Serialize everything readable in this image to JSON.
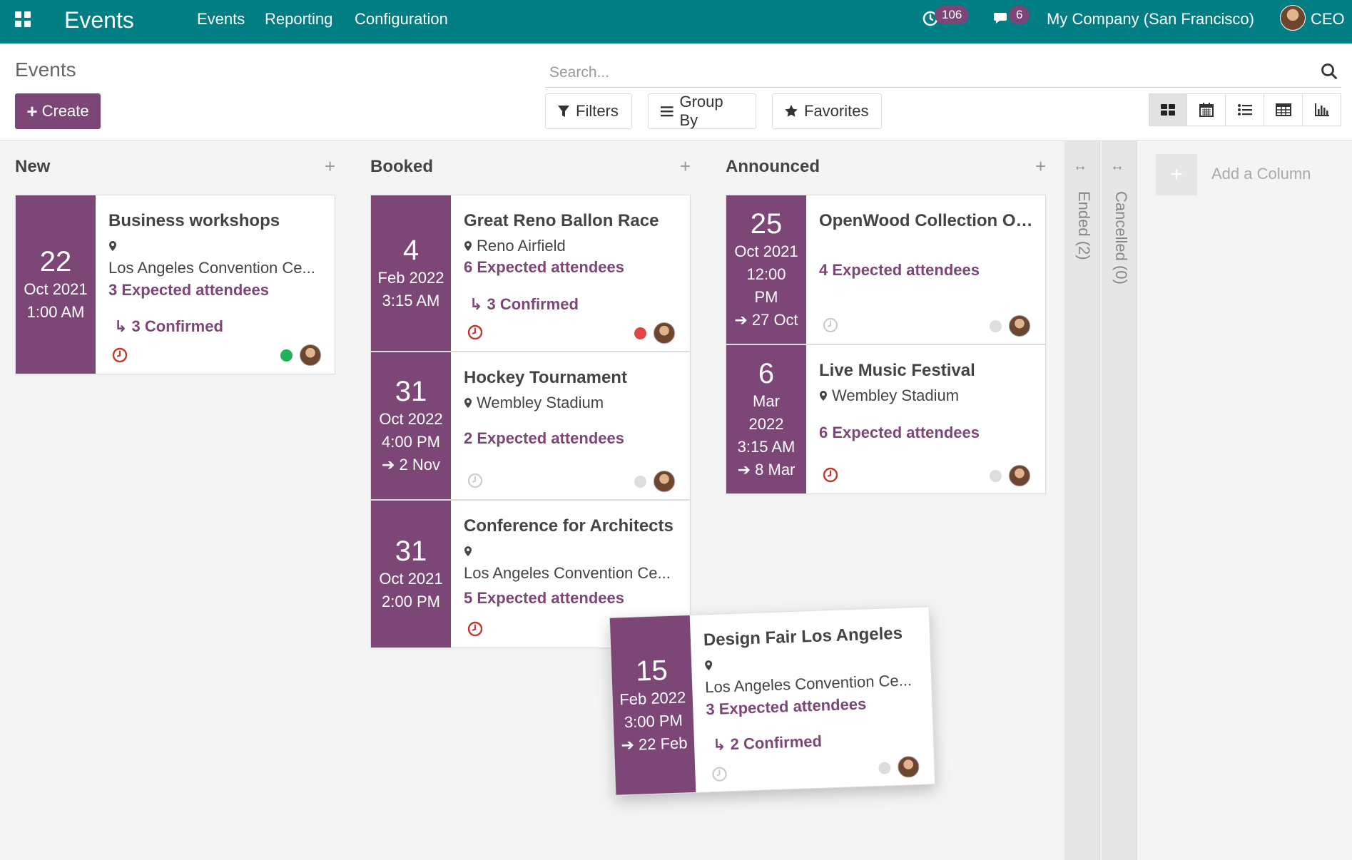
{
  "navbar": {
    "brand": "Events",
    "menu": [
      "Events",
      "Reporting",
      "Configuration"
    ],
    "activity_count": "106",
    "message_count": "6",
    "company": "My Company (San Francisco)",
    "user": "CEO"
  },
  "control_panel": {
    "title": "Events",
    "create_label": "Create",
    "search_placeholder": "Search...",
    "filters_label": "Filters",
    "group_by_label": "Group By",
    "favorites_label": "Favorites",
    "views": [
      "kanban",
      "calendar",
      "list",
      "pivot",
      "graph"
    ]
  },
  "columns": {
    "new": "New",
    "booked": "Booked",
    "announced": "Announced",
    "ended": "Ended (2)",
    "cancelled": "Cancelled (0)",
    "add_column": "Add a Column"
  },
  "cards": {
    "c1": {
      "day": "22",
      "l1": "Oct 2021",
      "l2": "1:00 AM",
      "title": "Business workshops",
      "location": "Los Angeles Convention Ce...",
      "attendees": "3 Expected attendees",
      "confirmed": "3 Confirmed",
      "status": "green"
    },
    "c2": {
      "day": "4",
      "l1": "Feb 2022",
      "l2": "3:15 AM",
      "title": "Great Reno Ballon Race",
      "location": "Reno Airfield",
      "attendees": "6 Expected attendees",
      "confirmed": "3 Confirmed",
      "status": "red"
    },
    "c3": {
      "day": "31",
      "l1": "Oct 2022",
      "l2": "4:00 PM",
      "l3": "2 Nov",
      "title": "Hockey Tournament",
      "location": "Wembley Stadium",
      "attendees": "2 Expected attendees",
      "status": "grey"
    },
    "c4": {
      "day": "31",
      "l1": "Oct 2021",
      "l2": "2:00 PM",
      "title": "Conference for Architects",
      "location": "Los Angeles Convention Ce...",
      "attendees": "5 Expected attendees"
    },
    "c5": {
      "day": "25",
      "l1": "Oct 2021",
      "l2": "12:00",
      "l3": "PM",
      "l4": "27 Oct",
      "title": "OpenWood Collection Onl...",
      "attendees": "4 Expected attendees",
      "status": "grey"
    },
    "c6": {
      "day": "6",
      "l1": "Mar",
      "l2": "2022",
      "l3": "3:15 AM",
      "l4": "8 Mar",
      "title": "Live Music Festival",
      "location": "Wembley Stadium",
      "attendees": "6 Expected attendees",
      "status": "grey"
    },
    "c7": {
      "day": "15",
      "l1": "Feb 2022",
      "l2": "3:00 PM",
      "l3": "22 Feb",
      "title": "Design Fair Los Angeles",
      "location": "Los Angeles Convention Ce...",
      "attendees": "3 Expected attendees",
      "confirmed": "2 Confirmed",
      "status": "grey"
    }
  },
  "colors": {
    "brand": "#017e84",
    "accent": "#7c4676",
    "overdue": "#c0392b",
    "done": "#21b35a",
    "blocked": "#e04646"
  }
}
